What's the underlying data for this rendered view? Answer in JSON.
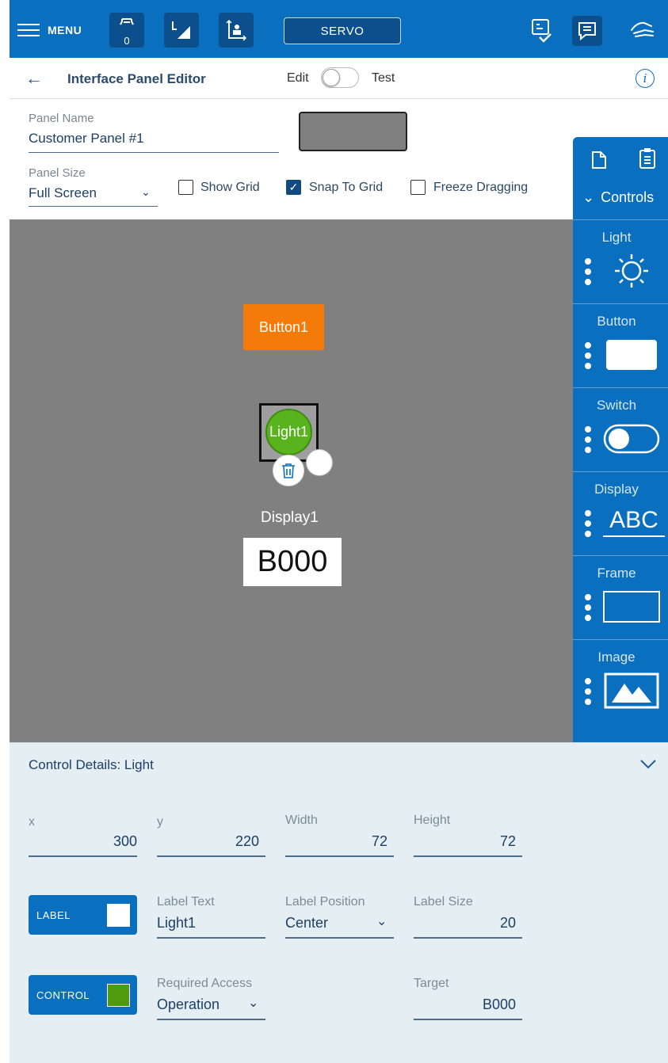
{
  "topbar": {
    "menu_label": "MENU",
    "gripper_count": "0",
    "servo_label": "SERVO",
    "icons": [
      "hamburger-icon",
      "gripper-icon",
      "angle-icon",
      "coordinate-icon",
      "checklist-icon",
      "message-icon",
      "hand-icon"
    ]
  },
  "header": {
    "title": "Interface Panel Editor",
    "edit_label": "Edit",
    "test_label": "Test",
    "mode_test_on": false
  },
  "settings": {
    "panel_name_label": "Panel Name",
    "panel_name_value": "Customer Panel #1",
    "panel_color": "#808080",
    "panel_size_label": "Panel Size",
    "panel_size_value": "Full Screen",
    "show_grid_label": "Show Grid",
    "show_grid_checked": false,
    "snap_to_grid_label": "Snap To Grid",
    "snap_to_grid_checked": true,
    "freeze_dragging_label": "Freeze Dragging",
    "freeze_dragging_checked": false
  },
  "canvas": {
    "background": "#808080",
    "button1_label": "Button1",
    "button1_color": "#f47b0a",
    "light1_label": "Light1",
    "light1_color": "#58b31c",
    "display1_label": "Display1",
    "display1_value": "B000"
  },
  "controls_panel": {
    "header": "Controls",
    "items": [
      {
        "label": "Light",
        "icon": "sun-icon"
      },
      {
        "label": "Button",
        "icon": "button-shape-icon"
      },
      {
        "label": "Switch",
        "icon": "switch-icon"
      },
      {
        "label": "Display",
        "icon": "abc-text-icon",
        "glyph_text": "ABC"
      },
      {
        "label": "Frame",
        "icon": "frame-icon"
      },
      {
        "label": "Image",
        "icon": "image-icon"
      }
    ]
  },
  "details": {
    "title": "Control Details: Light",
    "x_label": "x",
    "x_value": "300",
    "y_label": "y",
    "y_value": "220",
    "width_label": "Width",
    "width_value": "72",
    "height_label": "Height",
    "height_value": "72",
    "label_pill": "LABEL",
    "label_color": "#ffffff",
    "label_text_label": "Label Text",
    "label_text_value": "Light1",
    "label_position_label": "Label Position",
    "label_position_value": "Center",
    "label_size_label": "Label Size",
    "label_size_value": "20",
    "control_pill": "CONTROL",
    "control_color": "#4f9a0e",
    "required_access_label": "Required Access",
    "required_access_value": "Operation",
    "target_label": "Target",
    "target_value": "B000"
  }
}
